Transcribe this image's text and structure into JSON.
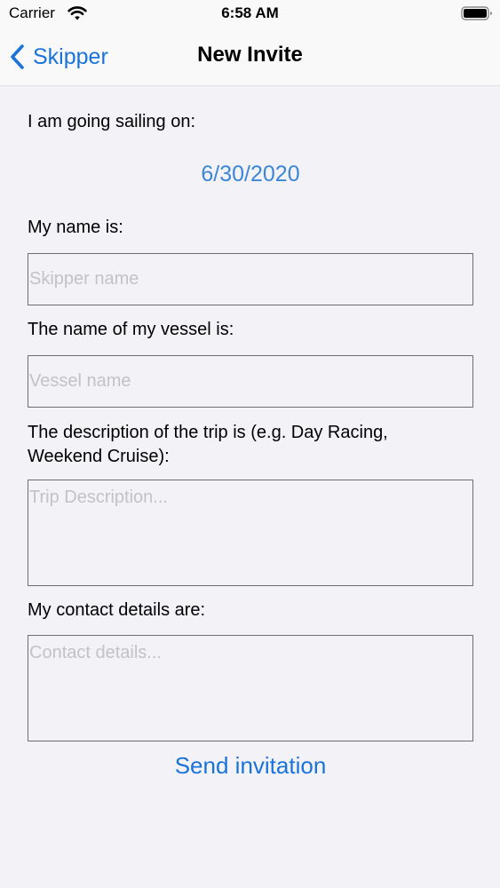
{
  "status_bar": {
    "carrier": "Carrier",
    "time": "6:58 AM",
    "wifi_icon": "wifi-icon",
    "battery_icon": "battery-full-icon"
  },
  "nav": {
    "back_label": "Skipper",
    "back_icon": "chevron-left-icon",
    "title": "New Invite"
  },
  "form": {
    "date_label": "I am going sailing on:",
    "date_value": "6/30/2020",
    "name_label": "My name is:",
    "name_value": "",
    "name_placeholder": "Skipper name",
    "vessel_label": "The name of my vessel is:",
    "vessel_value": "",
    "vessel_placeholder": "Vessel name",
    "description_label_line1": "The description of the trip is (e.g. Day Racing,",
    "description_label_line2": "Weekend Cruise):",
    "description_value": "",
    "description_placeholder": "Trip Description...",
    "contact_label": "My contact details are:",
    "contact_value": "",
    "contact_placeholder": "Contact details...",
    "send_label": "Send invitation"
  },
  "colors": {
    "accent": "#1a73d9",
    "date": "#3c86d8",
    "background": "#f2f2f7",
    "nav_background": "#f9f9f9",
    "field_border": "#6e6e6e",
    "placeholder": "#c3c3c7"
  }
}
